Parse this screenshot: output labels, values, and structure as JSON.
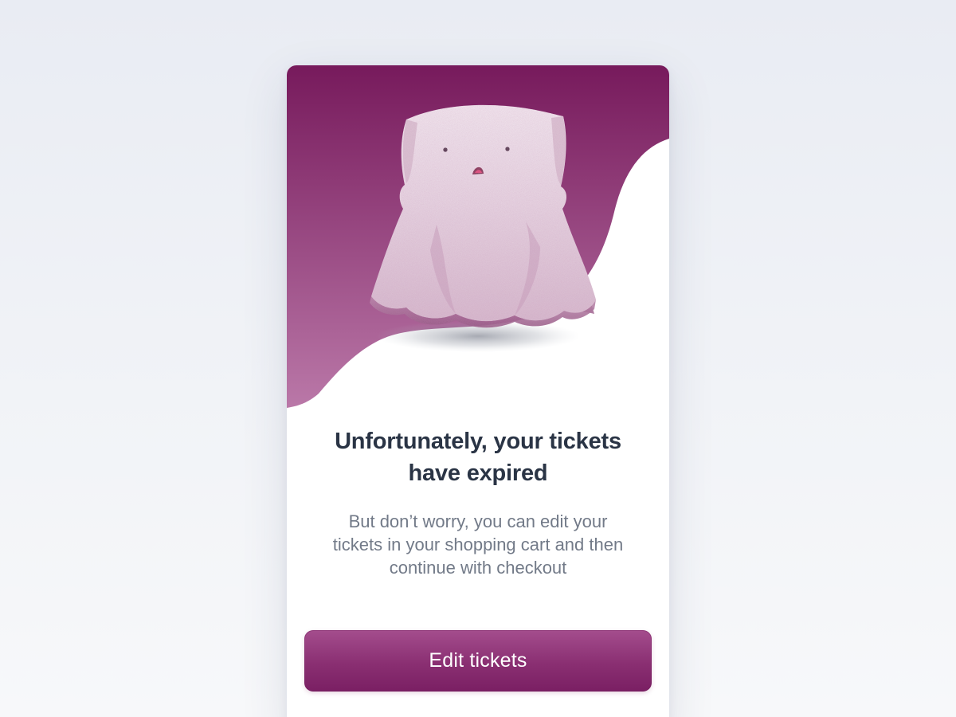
{
  "colors": {
    "hero_top": "#771a5c",
    "hero_bottom": "#ba78a8",
    "title": "#2a3445",
    "body_text": "#727a88",
    "button_top": "#a44d8d",
    "button_bottom": "#7a1f63",
    "button_text": "#ffffff"
  },
  "illustration": {
    "icon": "ghost-icon"
  },
  "dialog": {
    "title_lines": [
      "Unfortunately, your tickets",
      "have expired"
    ],
    "message_lines": [
      "But don’t worry, you can edit your",
      "tickets in your shopping cart and then",
      "continue with checkout"
    ]
  },
  "actions": {
    "primary_label": "Edit tickets"
  }
}
